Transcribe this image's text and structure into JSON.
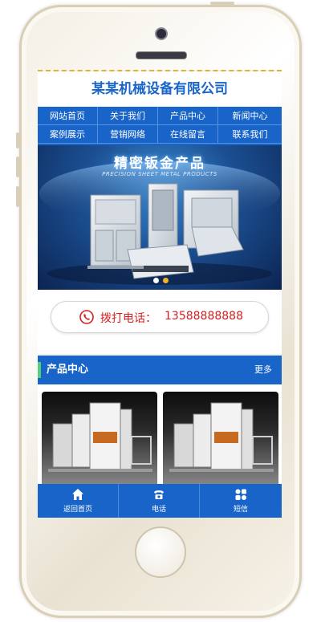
{
  "site": {
    "title": "某某机械设备有限公司"
  },
  "nav": {
    "items": [
      {
        "label": "网站首页"
      },
      {
        "label": "关于我们"
      },
      {
        "label": "产品中心"
      },
      {
        "label": "新闻中心"
      },
      {
        "label": "案例展示"
      },
      {
        "label": "营销网络"
      },
      {
        "label": "在线留言"
      },
      {
        "label": "联系我们"
      }
    ]
  },
  "banner": {
    "title": "精密钣金产品",
    "subtitle": "PRECISION SHEET METAL PRODUCTS",
    "active_slide": 1,
    "slide_count": 2
  },
  "call": {
    "label": "拨打电话：",
    "number": "13588888888",
    "icon": "phone-icon"
  },
  "products_section": {
    "title": "产品中心",
    "more": "更多"
  },
  "bottom_nav": {
    "items": [
      {
        "label": "返回首页",
        "icon": "home-icon"
      },
      {
        "label": "电话",
        "icon": "telephone-icon"
      },
      {
        "label": "短信",
        "icon": "message-icon"
      }
    ]
  },
  "colors": {
    "primary": "#1864c8",
    "accent_red": "#d62020",
    "dash": "#e0b432",
    "section_mark": "#54d07a"
  }
}
